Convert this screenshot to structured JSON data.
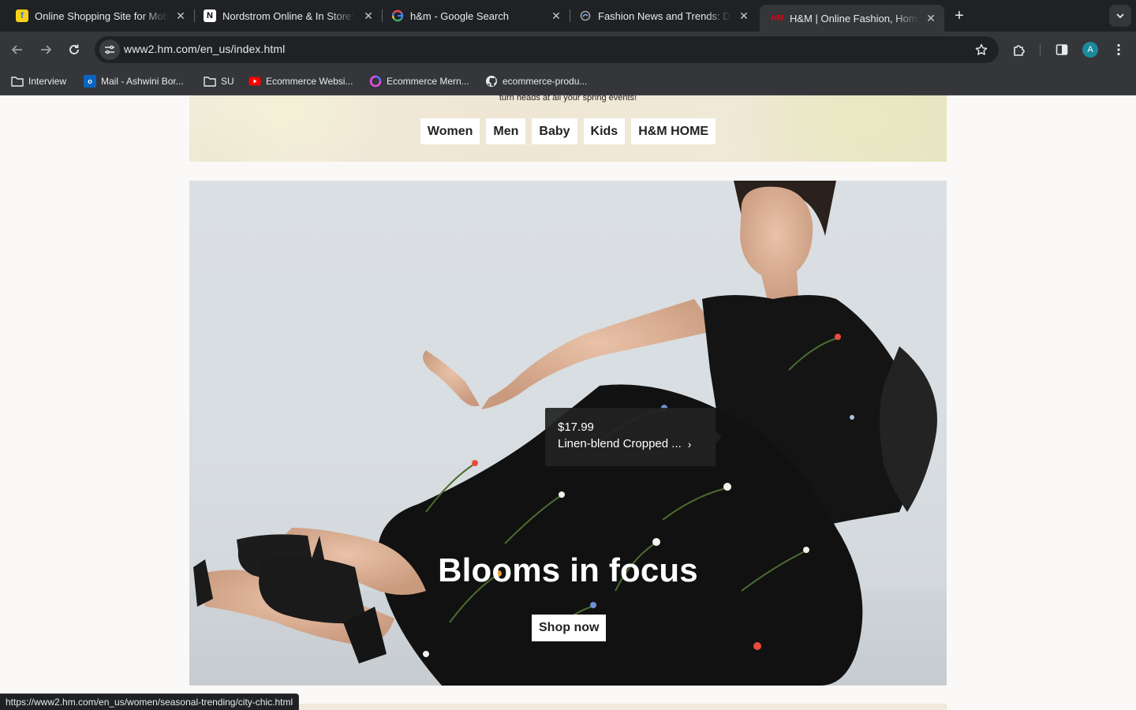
{
  "browser": {
    "tabs": [
      {
        "title": "Online Shopping Site for Mobiles",
        "favicon": "flipkart-icon"
      },
      {
        "title": "Nordstrom Online & In Store: Shoes",
        "favicon": "nordstrom-icon"
      },
      {
        "title": "h&m - Google Search",
        "favicon": "google-icon"
      },
      {
        "title": "Fashion News and Trends: Design",
        "favicon": "fashion-site-icon"
      },
      {
        "title": "H&M | Online Fashion, Homeware",
        "favicon": "hm-icon",
        "active": true
      }
    ],
    "url": "www2.hm.com/en_us/index.html",
    "profile_initial": "A",
    "bookmarks": [
      {
        "label": "Interview",
        "icon": "folder-icon"
      },
      {
        "label": "Mail - Ashwini Bor...",
        "icon": "outlook-icon"
      },
      {
        "label": "SU",
        "icon": "folder-icon"
      },
      {
        "label": "Ecommerce Websi...",
        "icon": "youtube-icon"
      },
      {
        "label": "Ecommerce Mern...",
        "icon": "loader-icon"
      },
      {
        "label": "ecommerce-produ...",
        "icon": "github-icon"
      }
    ],
    "status_url": "https://www2.hm.com/en_us/women/seasonal-trending/city-chic.html"
  },
  "banner": {
    "subtitle": "turn heads at all your spring events!",
    "categories": [
      "Women",
      "Men",
      "Baby",
      "Kids",
      "H&M HOME"
    ]
  },
  "hero": {
    "title": "Blooms in focus",
    "cta": "Shop now",
    "product_tag": {
      "price": "$17.99",
      "name": "Linen-blend Cropped ..."
    }
  },
  "colors": {
    "chrome_dark": "#202124",
    "chrome_toolbar": "#35363a",
    "page_bg": "#faf9f8",
    "avatar": "#1a8a9a"
  }
}
